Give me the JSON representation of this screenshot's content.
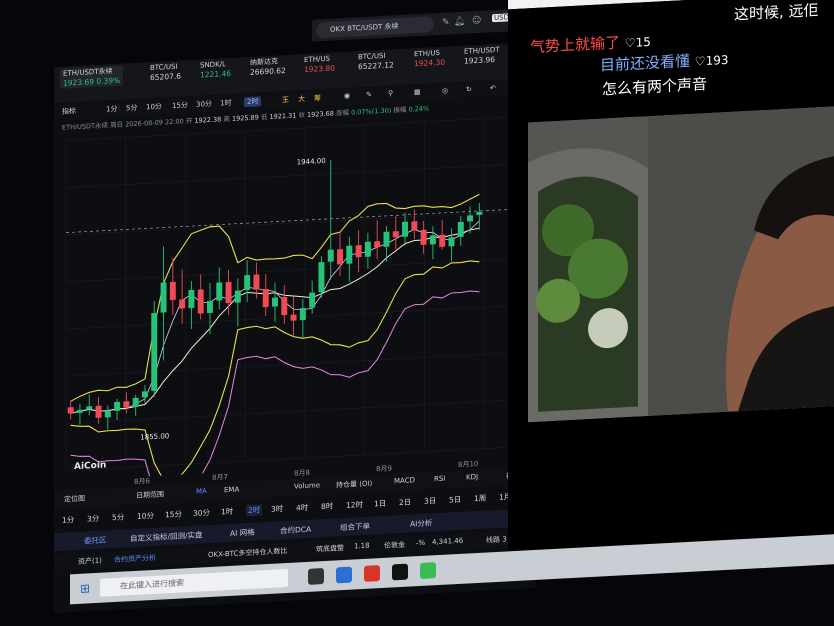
{
  "search": {
    "placeholder": "OKX BTC/USDT 永续"
  },
  "currency": "USD",
  "tickers": [
    {
      "name": "ETH/USDT永续",
      "price": "1923.69",
      "change": "0.39%"
    },
    {
      "name": "BTC/USI",
      "price": "65207.6"
    },
    {
      "name": "SNDK/L",
      "price": "1221.46"
    },
    {
      "name": "纳斯达克",
      "price": "26690.62"
    },
    {
      "name": "ETH/US",
      "price": "1923.80"
    },
    {
      "name": "BTC/USI",
      "price": "65227.12"
    },
    {
      "name": "ETH/US",
      "price": "1924.30"
    },
    {
      "name": "ETH/USDT",
      "price": "1923.96"
    }
  ],
  "ticker_extra": "未命",
  "tools": {
    "indicator": "指标",
    "timeframes": [
      "1分",
      "5分",
      "10分"
    ],
    "intraday": [
      "15分",
      "30分",
      "1时",
      "2时"
    ],
    "selected": "2时",
    "marks": [
      "王",
      "大",
      "筹"
    ]
  },
  "info_line": {
    "symbol": "ETH/USDT永续",
    "period": "周日 2026-08-09 22:00",
    "open": "1922.38",
    "high": "1925.89",
    "low": "1921.31",
    "close": "1923.68",
    "change": "0.07%(1.30)",
    "amplitude": "0.24%",
    "labels": {
      "open": "开",
      "high": "高",
      "low": "低",
      "close": "收",
      "change": "涨幅",
      "amplitude": "振幅"
    }
  },
  "chart_data": {
    "type": "candlestick",
    "x_ticks": [
      "8月6",
      "8月7",
      "8月8",
      "8月9",
      "8月10"
    ],
    "high_label": "1944.00",
    "low_label": "1855.00",
    "ylim": [
      1845,
      1955
    ],
    "candles": [
      [
        1866,
        1868,
        1862,
        1864
      ],
      [
        1864,
        1867,
        1860,
        1865
      ],
      [
        1865,
        1870,
        1863,
        1866
      ],
      [
        1866,
        1869,
        1860,
        1862
      ],
      [
        1862,
        1866,
        1858,
        1864
      ],
      [
        1864,
        1868,
        1861,
        1867
      ],
      [
        1867,
        1870,
        1863,
        1865
      ],
      [
        1865,
        1869,
        1862,
        1868
      ],
      [
        1868,
        1872,
        1866,
        1870
      ],
      [
        1870,
        1900,
        1868,
        1896
      ],
      [
        1896,
        1918,
        1880,
        1906
      ],
      [
        1906,
        1914,
        1895,
        1900
      ],
      [
        1900,
        1910,
        1892,
        1897
      ],
      [
        1897,
        1906,
        1890,
        1903
      ],
      [
        1903,
        1908,
        1893,
        1895
      ],
      [
        1895,
        1905,
        1888,
        1899
      ],
      [
        1899,
        1910,
        1896,
        1905
      ],
      [
        1905,
        1909,
        1894,
        1898
      ],
      [
        1898,
        1906,
        1890,
        1902
      ],
      [
        1902,
        1912,
        1898,
        1907
      ],
      [
        1907,
        1911,
        1899,
        1902
      ],
      [
        1902,
        1907,
        1893,
        1896
      ],
      [
        1896,
        1904,
        1891,
        1899
      ],
      [
        1899,
        1903,
        1890,
        1893
      ],
      [
        1893,
        1899,
        1886,
        1891
      ],
      [
        1891,
        1898,
        1885,
        1895
      ],
      [
        1895,
        1904,
        1893,
        1900
      ],
      [
        1900,
        1912,
        1898,
        1910
      ],
      [
        1910,
        1944,
        1904,
        1914
      ],
      [
        1914,
        1920,
        1905,
        1909
      ],
      [
        1909,
        1918,
        1903,
        1915
      ],
      [
        1915,
        1920,
        1906,
        1911
      ],
      [
        1911,
        1919,
        1907,
        1916
      ],
      [
        1916,
        1923,
        1910,
        1914
      ],
      [
        1914,
        1921,
        1909,
        1919
      ],
      [
        1919,
        1924,
        1913,
        1917
      ],
      [
        1917,
        1925,
        1914,
        1922
      ],
      [
        1922,
        1926,
        1916,
        1919
      ],
      [
        1919,
        1922,
        1911,
        1914
      ],
      [
        1914,
        1920,
        1909,
        1917
      ],
      [
        1917,
        1922,
        1912,
        1913
      ],
      [
        1913,
        1919,
        1908,
        1916
      ],
      [
        1916,
        1923,
        1913,
        1921
      ],
      [
        1921,
        1926,
        1917,
        1923
      ],
      [
        1923,
        1927,
        1918,
        1924
      ]
    ],
    "dashed_line_level": 1924.3
  },
  "watermark": "AiCoin",
  "bar1": [
    "定位图",
    "日期范围",
    "MA",
    "EMA",
    "Volume",
    "持仓量 (OI)",
    "MACD",
    "RSI",
    "KDJ",
    "社区"
  ],
  "bar2": [
    "1分",
    "3分",
    "5分",
    "10分",
    "15分",
    "30分",
    "1时",
    "2时",
    "3时",
    "4时",
    "8时",
    "12时",
    "1日",
    "2日",
    "3日",
    "5日",
    "1周",
    "1月"
  ],
  "bar2_selected": "2时",
  "bar3": [
    "委托区",
    "自定义指标/回测/实盘",
    "AI 网格",
    "合约DCA",
    "组合下单",
    "AI分析"
  ],
  "bar4": {
    "left": "资产(1)",
    "link": "合约资产分析",
    "text": "OKX-BTC多空持仓人数比",
    "label2": "筑底盘整",
    "v1": "1.18",
    "label3": "伦敦金",
    "v2": "-%",
    "v3": "4,341.46",
    "line": "线路 3"
  },
  "video_comments": [
    {
      "text": "这时候, 远佢",
      "likes": ""
    },
    {
      "text": "气势上就输了",
      "likes": "15"
    },
    {
      "text": "目前还没看懂",
      "likes": "193"
    },
    {
      "text": "怎么有两个声音",
      "likes": ""
    }
  ],
  "taskbar": {
    "search_placeholder": "在此键入进行搜索"
  }
}
